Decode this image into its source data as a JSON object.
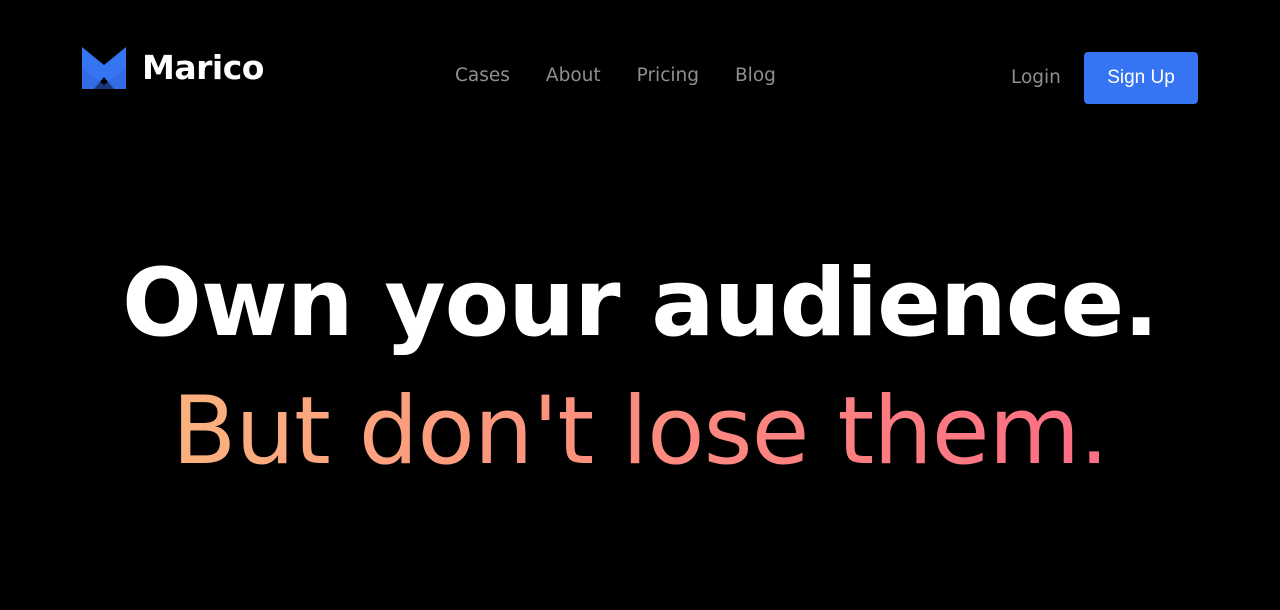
{
  "brand": {
    "name": "Marico",
    "logo_icon": "marico-m-logo-icon",
    "logo_color": "#3574f2"
  },
  "nav": {
    "links": [
      {
        "label": "Cases"
      },
      {
        "label": "About"
      },
      {
        "label": "Pricing"
      },
      {
        "label": "Blog"
      }
    ]
  },
  "auth": {
    "login_label": "Login",
    "signup_label": "Sign Up",
    "signup_color": "#3574f2"
  },
  "hero": {
    "headline_line1": "Own your audience.",
    "headline_line2": "But don't lose them.",
    "line2_gradient": [
      "#fbb27e",
      "#fc8f7e",
      "#fd6e84"
    ]
  },
  "colors": {
    "background": "#000000",
    "nav_text": "#8f8f8f",
    "headline": "#ffffff"
  }
}
